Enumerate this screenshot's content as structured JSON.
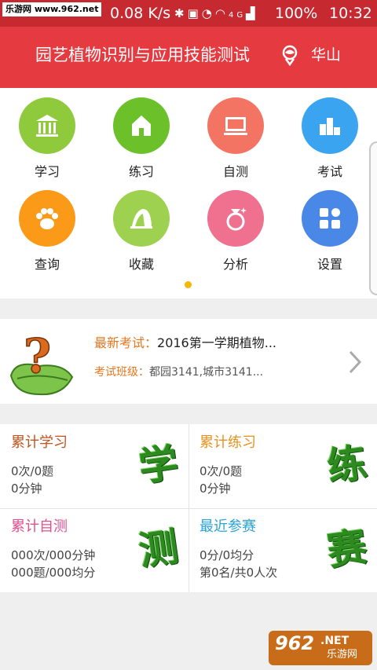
{
  "status_bar": {
    "watermark": "乐游网 www.962.net",
    "net_speed": "0.08 K/s",
    "icons": [
      "bluetooth-icon",
      "nfc-icon",
      "alarm-icon",
      "wifi-icon",
      "4g-icon",
      "signal-icon"
    ],
    "network_type": "4G",
    "battery": "100%",
    "time": "10:32"
  },
  "header": {
    "title": "园艺植物识别与应用技能测试",
    "school": "华山",
    "color": "#e53a40"
  },
  "menu": {
    "items": [
      {
        "label": "学习",
        "icon": "bank-icon",
        "color": "#8fca3c"
      },
      {
        "label": "练习",
        "icon": "house-icon",
        "color": "#6cc12b"
      },
      {
        "label": "自测",
        "icon": "monitor-icon",
        "color": "#f47464"
      },
      {
        "label": "考试",
        "icon": "podium-icon",
        "color": "#3aa4f0"
      },
      {
        "label": "查询",
        "icon": "paw-icon",
        "color": "#fb9a19"
      },
      {
        "label": "收藏",
        "icon": "bookmark-icon",
        "color": "#9fd150"
      },
      {
        "label": "分析",
        "icon": "ring-icon",
        "color": "#f0708f"
      },
      {
        "label": "设置",
        "icon": "grid-icon",
        "color": "#4a88e8"
      }
    ],
    "page_indicator_color": "#f5b700"
  },
  "exam": {
    "latest_label": "最新考试：",
    "latest_value": "2016第一学期植物...",
    "class_label": "考试班级：",
    "class_value": "都园3141,城市3141..."
  },
  "stats": [
    {
      "title": "累计学习",
      "line1": "0次/0题",
      "line2": "0分钟",
      "char": "学",
      "title_color": "#c0541f"
    },
    {
      "title": "累计练习",
      "line1": "0次/0题",
      "line2": "0分钟",
      "char": "练",
      "title_color": "#e8921e"
    },
    {
      "title": "累计自测",
      "line1": "000次/000分钟",
      "line2": "000题/000均分",
      "char": "测",
      "title_color": "#e24d8e"
    },
    {
      "title": "最近参赛",
      "line1": "0分/0均分",
      "line2": "第0名/共0人次",
      "char": "赛",
      "title_color": "#2aa3d8"
    }
  ],
  "watermark_bottom": {
    "number": "962",
    "suffix": ".NET",
    "site": "乐游网"
  }
}
